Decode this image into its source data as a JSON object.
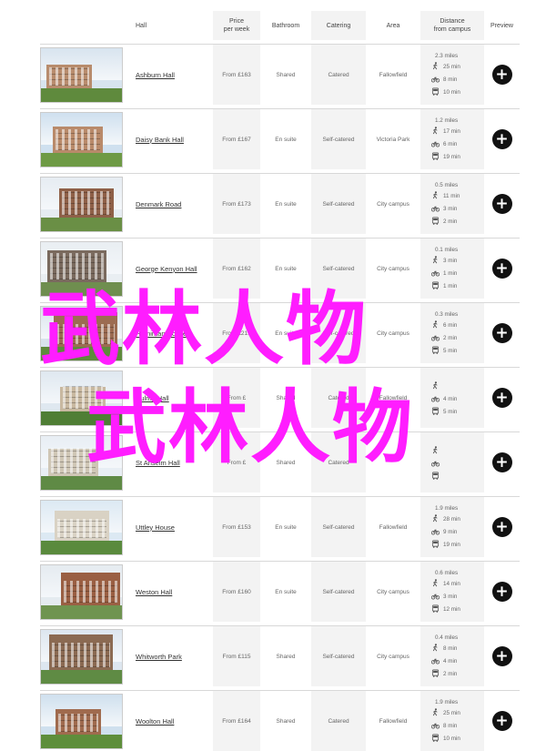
{
  "header": {
    "hall": "Hall",
    "price_line1": "Price",
    "price_line2": "per week",
    "bathroom": "Bathroom",
    "catering": "Catering",
    "area": "Area",
    "distance_line1": "Distance",
    "distance_line2": "from campus",
    "preview": "Preview"
  },
  "icons": {
    "walk": "walking-person-icon",
    "cycle": "bicycle-icon",
    "bus": "bus-icon",
    "preview": "plus-icon"
  },
  "colors": {
    "overlay_text": "#ff1dff",
    "header_shade": "#f3f3f3",
    "preview_button": "#111111"
  },
  "overlay": {
    "line1": "武林人物",
    "line2": "武林人物"
  },
  "rows": [
    {
      "name": "Ashburn Hall",
      "price": "From £163",
      "bathroom": "Shared",
      "catering": "Catered",
      "area": "Fallowfield",
      "miles": "2.3 miles",
      "walk": "25 min",
      "cycle": "8 min",
      "bus": "10 min"
    },
    {
      "name": "Daisy Bank Hall",
      "price": "From £167",
      "bathroom": "En suite",
      "catering": "Self-catered",
      "area": "Victoria Park",
      "miles": "1.2 miles",
      "walk": "17 min",
      "cycle": "6 min",
      "bus": "19 min"
    },
    {
      "name": "Denmark Road",
      "price": "From £173",
      "bathroom": "En suite",
      "catering": "Self-catered",
      "area": "City campus",
      "miles": "0.5 miles",
      "walk": "11 min",
      "cycle": "3 min",
      "bus": "2 min"
    },
    {
      "name": "George Kenyon Hall",
      "price": "From £162",
      "bathroom": "En suite",
      "catering": "Self-catered",
      "area": "City campus",
      "miles": "0.1 miles",
      "walk": "3 min",
      "cycle": "1 min",
      "bus": "1 min"
    },
    {
      "name": "Horniman House",
      "price": "From £219",
      "bathroom": "En suite",
      "catering": "Self-catered",
      "area": "City campus",
      "miles": "0.3 miles",
      "walk": "6 min",
      "cycle": "2 min",
      "bus": "5 min"
    },
    {
      "name": "Hulme Hall",
      "price": "From £",
      "bathroom": "Shared",
      "catering": "Catered",
      "area": "Fallowfield",
      "miles": "",
      "walk": "",
      "cycle": "4 min",
      "bus": "5 min"
    },
    {
      "name": "St Anselm Hall",
      "price": "From £",
      "bathroom": "Shared",
      "catering": "Catered",
      "area": "",
      "miles": "",
      "walk": "",
      "cycle": "",
      "bus": ""
    },
    {
      "name": "Uttley House",
      "price": "From £153",
      "bathroom": "En suite",
      "catering": "Self-catered",
      "area": "Fallowfield",
      "miles": "1.9 miles",
      "walk": "28 min",
      "cycle": "9 min",
      "bus": "19 min"
    },
    {
      "name": "Weston Hall",
      "price": "From £160",
      "bathroom": "En suite",
      "catering": "Self-catered",
      "area": "City campus",
      "miles": "0.6 miles",
      "walk": "14 min",
      "cycle": "3 min",
      "bus": "12 min"
    },
    {
      "name": "Whitworth Park",
      "price": "From £115",
      "bathroom": "Shared",
      "catering": "Self-catered",
      "area": "City campus",
      "miles": "0.4 miles",
      "walk": "8 min",
      "cycle": "4 min",
      "bus": "2 min"
    },
    {
      "name": "Woolton Hall",
      "price": "From £164",
      "bathroom": "Shared",
      "catering": "Catered",
      "area": "Fallowfield",
      "miles": "1.9 miles",
      "walk": "25 min",
      "cycle": "8 min",
      "bus": "10 min"
    }
  ]
}
